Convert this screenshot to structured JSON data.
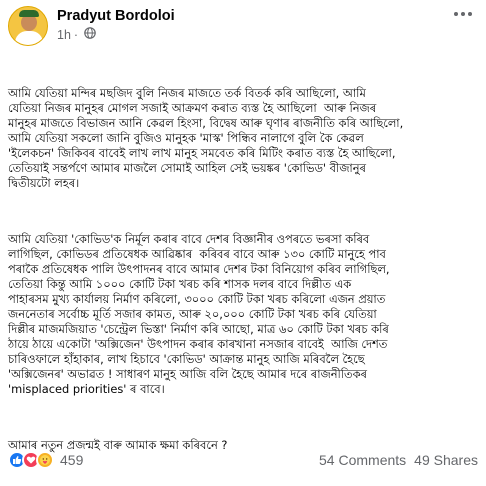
{
  "post": {
    "author": "Pradyut Bordoloi",
    "time": "1h",
    "separator": "·",
    "paragraphs": [
      "আমি যেতিয়া মন্দিৰ মছজিদ বুলি নিজৰ মাজতে তৰ্ক বিতৰ্ক কৰি আছিলো, আমি\nযেতিয়া নিজৰ মানুহৰ মোগল সজাই আক্ৰমণ কৰাত ব্যস্ত হৈ আছিলো  আৰু নিজৰ\nমানুহৰ মাজতে বিভাজন আনি কেৱল হিংসা, বিদ্বেষ আৰু ঘৃণাৰ ৰাজনীতি কৰি আছিলো,\nআমি যেতিয়া সকলো জানি বুজিও মানুহক 'মাস্ক' পিন্ধিব নালাগে বুলি কৈ কেৱল\n'ইলেকচন' জিকিবৰ বাবেই লাখ লাখ মানুহ সমবেত কৰি মিটিং কৰাত ব্যস্ত হৈ আছিলো,\nতেতিয়াই সন্তৰ্পণে আমাৰ মাজলৈ সোমাই আহিল সেই ভয়ঙ্কৰ 'কোভিড' বীজানুৰ\nদ্বিতীয়টো লহৰ।",
      "আমি যেতিয়া 'কোভিড'ক নিৰ্মূল কৰাৰ বাবে দেশৰ বিজ্ঞানীৰ ওপৰতে ভৰসা কৰিব\nলাগিছিল, কোভিডৰ প্ৰতিষেধক আৱিষ্কাৰ  কৰিবৰ বাবে আৰু ১৩০ কোটি মানুহে পাব\nপৰাকৈ প্ৰতিষেধক পালি উৎপাদনৰ বাবে আমাৰ দেশৰ টকা বিনিয়োগ কৰিব লাগিছিল,\nতেতিয়া কিন্তু আমি ১০০০ কোটি টকা খৰচ কৰি শাসক দলৰ বাবে দিল্লীত এক\nপাহাৰসম মুখ্য কাৰ্যালয় নিৰ্মাণ কৰিলো, ৩০০০ কোটি টকা খৰচ কৰিলো এজন প্ৰয়াত\nজননেতাৰ সৰ্বোচ্চ মূৰ্তি সজাৰ কামত, আৰু ২০,০০০ কোটি টকা খৰচ কৰি যেতিয়া\nদিল্লীৰ মাজমজিয়াত 'চেন্ট্ৰেল ভিস্তা' নিৰ্মাণ কৰি আছো, মাত্ৰ ৬০ কোটি টকা খৰচ কৰি\nঠায়ে ঠায়ে একোটা 'অক্সিজেন' উৎপাদন কৰাৰ কাৰখানা নসজাৰ বাবেই  আজি দেশত\nচাৰিওফালে হাঁহাকাৰ, লাখ হিচাবে 'কোভিড' আক্ৰান্ত মানুহ আজি মৰিবলৈ হৈছে\n'অক্সিজেনৰ' অভাৱত ! সাধাৰণ মানুহ আজি বলি হৈছে আমাৰ দৰে ৰাজনীতিকৰ\n'misplaced priorities' ৰ বাবে।",
      "আমাৰ নতুন প্ৰজন্মই বাৰু আমাক ক্ষমা কৰিবনে ?"
    ]
  },
  "footer": {
    "reaction_count": "459",
    "comments": "54 Comments",
    "shares": "49 Shares"
  },
  "icons": {
    "like": "like-icon",
    "love": "love-icon",
    "care": "care-icon",
    "globe": "globe-icon",
    "more": "more-options-icon"
  },
  "colors": {
    "like": "#1877f2",
    "love": "#f33e58",
    "care": "#f7b125",
    "secondary_text": "#65676b"
  }
}
